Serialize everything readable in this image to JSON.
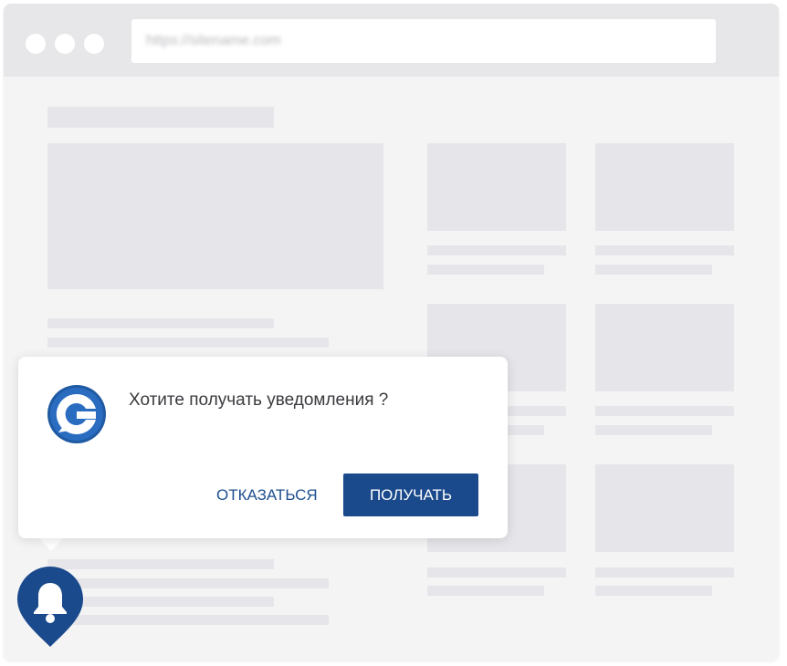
{
  "browser": {
    "url": "https://sitename.com"
  },
  "prompt": {
    "message": "Хотите получать уведомления ?",
    "deny_label": "ОТКАЗАТЬСЯ",
    "accept_label": "ПОЛУЧАТЬ"
  },
  "icons": {
    "logo": "brand-logo-g-icon",
    "bell": "bell-icon"
  },
  "colors": {
    "accent": "#1a4a8c",
    "deny_text": "#1d4f8f",
    "placeholder": "#e6e6ea",
    "page_bg": "#f4f4f5",
    "titlebar": "#e7e7ea"
  }
}
